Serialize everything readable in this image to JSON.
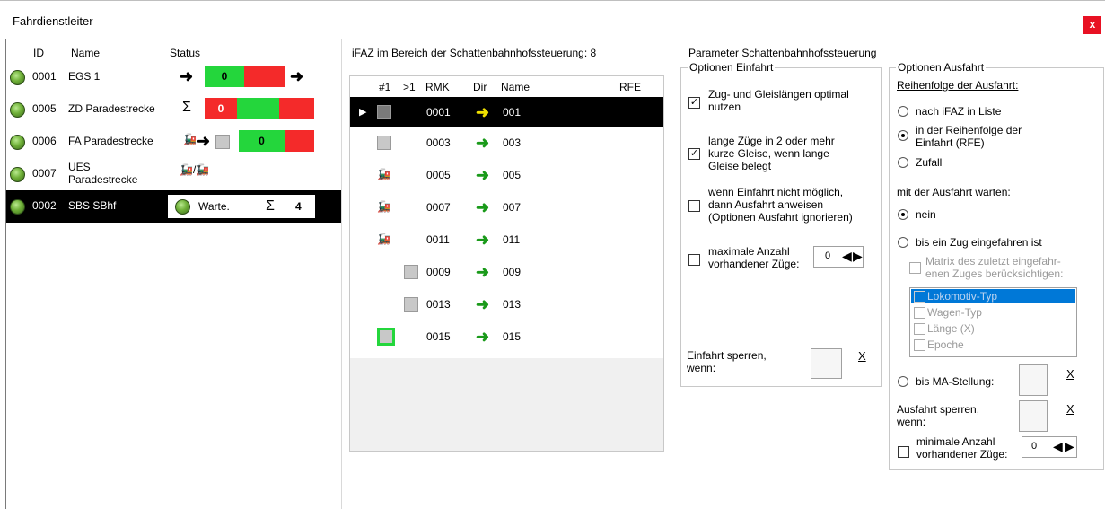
{
  "window": {
    "title": "Fahrdienstleiter",
    "close_label": "x"
  },
  "left": {
    "headers": {
      "id": "ID",
      "name": "Name",
      "status": "Status"
    },
    "rows": [
      {
        "id": "0001",
        "name": "EGS 1",
        "status_value": "0"
      },
      {
        "id": "0005",
        "name": "ZD Paradestrecke",
        "status_value": "0",
        "sigma": "Σ"
      },
      {
        "id": "0006",
        "name": "FA Paradestrecke",
        "status_value": "0"
      },
      {
        "id": "0007",
        "name": "UES",
        "name2": "Paradestrecke"
      },
      {
        "id": "0002",
        "name": "SBS SBhf",
        "status_text": "Warte.",
        "sigma": "Σ",
        "count": "4"
      }
    ]
  },
  "mid": {
    "caption": "iFAZ im Bereich der Schattenbahnhofssteuerung: 8",
    "headers": {
      "c1": "#1",
      "c2": ">1",
      "rmk": "RMK",
      "dir": "Dir",
      "name": "Name",
      "rfe": "RFE"
    },
    "rows": [
      {
        "rmk": "0001",
        "name": "001"
      },
      {
        "rmk": "0003",
        "name": "003"
      },
      {
        "rmk": "0005",
        "name": "005"
      },
      {
        "rmk": "0007",
        "name": "007"
      },
      {
        "rmk": "0011",
        "name": "011"
      },
      {
        "rmk": "0009",
        "name": "009"
      },
      {
        "rmk": "0013",
        "name": "013"
      },
      {
        "rmk": "0015",
        "name": "015"
      }
    ]
  },
  "params": {
    "caption": "Parameter Schattenbahnhofssteuerung",
    "einfahrt": {
      "title": "Optionen Einfahrt",
      "opt1a": "Zug- und Gleislängen optimal",
      "opt1b": "nutzen",
      "opt2a": "lange Züge in 2 oder mehr",
      "opt2b": "kurze Gleise, wenn lange",
      "opt2c": "Gleise belegt",
      "opt3a": "wenn Einfahrt nicht möglich,",
      "opt3b": "dann Ausfahrt anweisen",
      "opt3c": "(Optionen Ausfahrt ignorieren)",
      "opt4a": "maximale Anzahl",
      "opt4b": "vorhandener Züge:",
      "opt4_value": "0",
      "sperren_a": "Einfahrt sperren,",
      "sperren_b": "wenn:",
      "x": "X"
    },
    "ausfahrt": {
      "title": "Optionen Ausfahrt",
      "reihenfolge": "Reihenfolge der Ausfahrt:",
      "r1": "nach iFAZ in Liste",
      "r2a": "in der Reihenfolge der",
      "r2b": "Einfahrt (RFE)",
      "r3": "Zufall",
      "warten": "mit der Ausfahrt warten:",
      "w1": "nein",
      "w2": "bis ein Zug eingefahren ist",
      "matrix_a": "Matrix des zuletzt eingefahr-",
      "matrix_b": "enen Zuges berücksichtigen:",
      "list": [
        "Lokomotiv-Typ",
        "Wagen-Typ",
        "Länge (X)",
        "Epoche"
      ],
      "w3": "bis MA-Stellung:",
      "sperren_a": "Ausfahrt sperren,",
      "sperren_b": "wenn:",
      "min_a": "minimale Anzahl",
      "min_b": "vorhandener Züge:",
      "min_value": "0",
      "x": "X"
    }
  }
}
